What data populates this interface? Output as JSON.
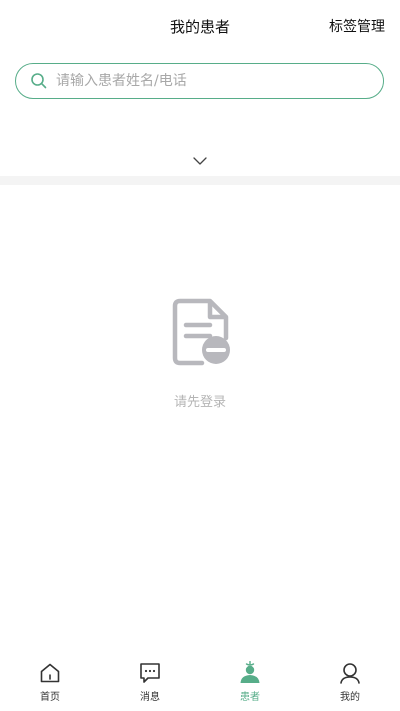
{
  "header": {
    "title": "我的患者",
    "tag_manage_label": "标签管理"
  },
  "search": {
    "placeholder": "请输入患者姓名/电话",
    "value": "",
    "icon": "search-icon"
  },
  "filter": {
    "expand_icon": "chevron-down-icon"
  },
  "empty_state": {
    "icon": "document-minus-icon",
    "message": "请先登录"
  },
  "tabbar": {
    "active_tab": "patients",
    "items": [
      {
        "key": "home",
        "label": "首页",
        "icon": "home-icon"
      },
      {
        "key": "messages",
        "label": "消息",
        "icon": "message-icon"
      },
      {
        "key": "patients",
        "label": "患者",
        "icon": "patient-icon"
      },
      {
        "key": "mine",
        "label": "我的",
        "icon": "user-icon"
      }
    ]
  },
  "colors": {
    "accent": "#57ad89",
    "text": "#111111",
    "placeholder": "#a8a8a8",
    "empty_text": "#b5b5b5",
    "divider": "#f4f4f4",
    "icon_gray": "#b8b8bd"
  }
}
